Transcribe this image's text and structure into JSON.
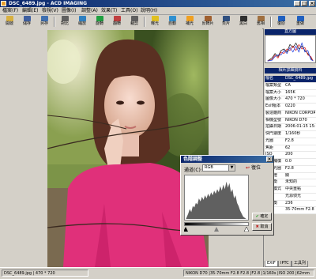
{
  "window": {
    "title": "DSC_6489.jpg - ACD IMAGING",
    "controls": [
      "_",
      "□",
      "×"
    ]
  },
  "menu": [
    "檔案(F)",
    "編輯(E)",
    "檢視(V)",
    "圖像(I)",
    "調整(A)",
    "效果(T)",
    "工具(O)",
    "說明(H)"
  ],
  "toolbar": {
    "buttons": [
      {
        "label": "開啟",
        "icon": "open-folder-icon",
        "color": "#d8b040"
      },
      {
        "label": "儲存",
        "icon": "save-icon",
        "color": "#4060a0"
      },
      {
        "label": "另存",
        "icon": "save-as-icon",
        "color": "#4070b0"
      },
      {
        "label": "對比",
        "icon": "contrast-icon",
        "color": "#606060"
      },
      {
        "label": "縮放",
        "icon": "zoom-icon",
        "color": "#3080c0"
      },
      {
        "label": "旋轉",
        "icon": "rotate-icon",
        "color": "#20a040"
      },
      {
        "label": "翻轉",
        "icon": "flip-icon",
        "color": "#c04040"
      },
      {
        "label": "裁剪",
        "icon": "crop-icon",
        "color": "#606060"
      },
      {
        "label": "曝光",
        "icon": "exposure-icon",
        "color": "#e0c020"
      },
      {
        "label": "自動",
        "icon": "auto-icon",
        "color": "#3090d0"
      },
      {
        "label": "補光",
        "icon": "fill-light-icon",
        "color": "#f0a020"
      },
      {
        "label": "反轉片",
        "icon": "reversal-film-icon",
        "color": "#a06030"
      },
      {
        "label": "負片",
        "icon": "negative-icon",
        "color": "#305080"
      },
      {
        "label": "黑白",
        "icon": "black-white-icon",
        "color": "#303030"
      },
      {
        "label": "舊相",
        "icon": "sepia-icon",
        "color": "#a07040"
      },
      {
        "label": "復原",
        "icon": "undo-icon",
        "color": "#2060c0"
      },
      {
        "label": "重做",
        "icon": "redo-icon",
        "color": "#2060c0"
      }
    ]
  },
  "side_panel": {
    "histogram_title": "直方圖",
    "exif_title": "相片詳細資料",
    "exif": [
      {
        "key": "檔名",
        "value": "DSC_6489.jpg"
      },
      {
        "key": "檔案類型",
        "value": "CA"
      },
      {
        "key": "檔案大小",
        "value": "165K"
      },
      {
        "key": "圖像大小",
        "value": "470 * 720"
      },
      {
        "key": "Exif版本",
        "value": "0220"
      },
      {
        "key": "製造廠商",
        "value": "NIKON CORPORA"
      },
      {
        "key": "相機型號",
        "value": "NIKON D70"
      },
      {
        "key": "拍攝日期",
        "value": "2006:01:15 15:53:0"
      },
      {
        "key": "快門速度",
        "value": "1/160秒"
      },
      {
        "key": "光圈",
        "value": "F2.8"
      },
      {
        "key": "焦距",
        "value": "62"
      },
      {
        "key": "ISO",
        "value": "200"
      },
      {
        "key": "曝光補償",
        "value": "0.0"
      },
      {
        "key": "最大光圈",
        "value": "F2.8"
      },
      {
        "key": "閃光燈",
        "value": "關"
      },
      {
        "key": "白平衡",
        "value": "未知的"
      },
      {
        "key": "測光模式",
        "value": "中央重點"
      },
      {
        "key": "光源",
        "value": "光源偵光"
      },
      {
        "key": "白平衡",
        "value": "236"
      },
      {
        "key": "鏡頭",
        "value": "35-70mm F2.8"
      }
    ],
    "tabs": [
      "EXIF",
      "IPTC",
      "工具列"
    ]
  },
  "dialog": {
    "title": "色階調整",
    "channel_label": "通道(C):",
    "channel_value": "RGB",
    "reset_label": "復位",
    "ok_label": "確定",
    "cancel_label": "取消"
  },
  "status": {
    "file": "DSC_6489.jpg | 470 * 720",
    "exif_summary": "NIKON D70 |35-70mm F2.8 F2.8 |F2.8 |1/160s |ISO 200 |62mm"
  },
  "colors": {
    "title_bar": "#0a246a",
    "face_bg": "#d4d0c8",
    "ok_check": "#20a020",
    "cancel_x": "#c02020",
    "reset_arrow": "#c02020",
    "histogram_red": "#e02020",
    "histogram_blue": "#2040e0"
  }
}
